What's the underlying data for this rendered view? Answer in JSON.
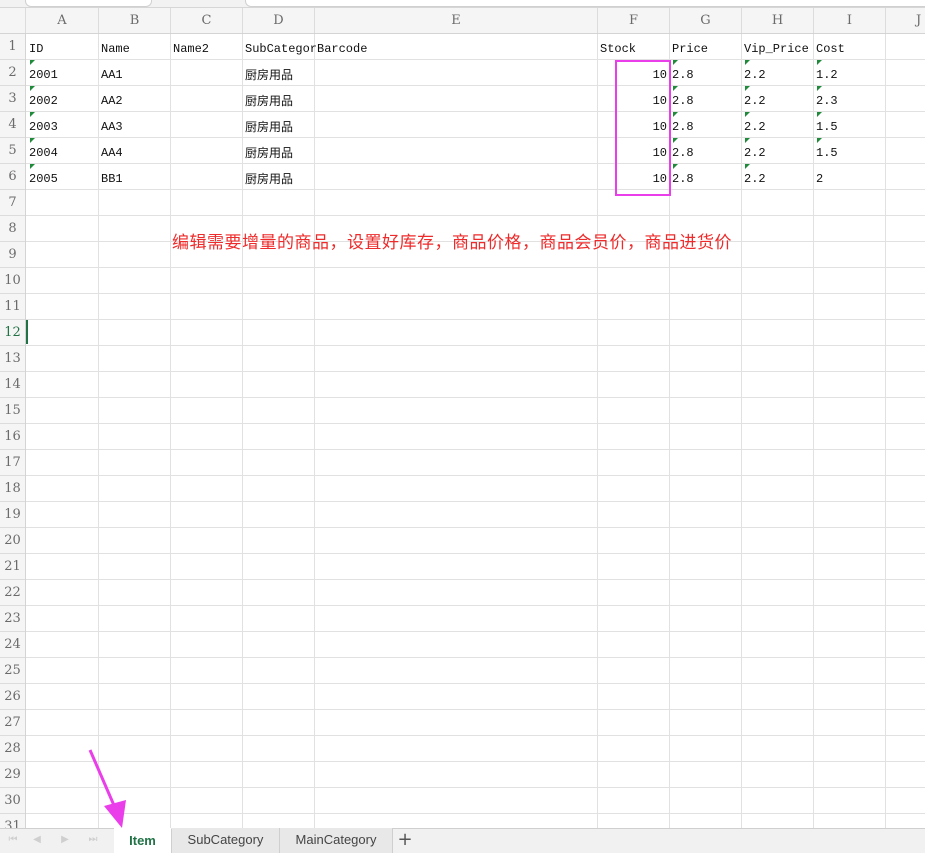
{
  "columns": [
    "A",
    "B",
    "C",
    "D",
    "E",
    "F",
    "G",
    "H",
    "I",
    "J"
  ],
  "rows": [
    "1",
    "2",
    "3",
    "4",
    "5",
    "6",
    "7",
    "8",
    "9",
    "10",
    "11",
    "12",
    "13",
    "14",
    "15",
    "16",
    "17",
    "18",
    "19",
    "20",
    "21",
    "22",
    "23",
    "24",
    "25",
    "26",
    "27",
    "28",
    "29",
    "30",
    "31"
  ],
  "active_row": "12",
  "headers": {
    "A": "ID",
    "B": "Name",
    "C": "Name2",
    "D": "SubCategor",
    "E": "Barcode",
    "F": "Stock",
    "G": "Price",
    "H": "Vip_Price",
    "I": "Cost"
  },
  "data_rows": [
    {
      "id": "2001",
      "name": "AA1",
      "subcategory": "厨房用品",
      "stock": "10",
      "price": "2.8",
      "vip_price": "2.2",
      "cost": "1.2"
    },
    {
      "id": "2002",
      "name": "AA2",
      "subcategory": "厨房用品",
      "stock": "10",
      "price": "2.8",
      "vip_price": "2.2",
      "cost": "2.3"
    },
    {
      "id": "2003",
      "name": "AA3",
      "subcategory": "厨房用品",
      "stock": "10",
      "price": "2.8",
      "vip_price": "2.2",
      "cost": "1.5"
    },
    {
      "id": "2004",
      "name": "AA4",
      "subcategory": "厨房用品",
      "stock": "10",
      "price": "2.8",
      "vip_price": "2.2",
      "cost": "1.5"
    },
    {
      "id": "2005",
      "name": "BB1",
      "subcategory": "厨房用品",
      "stock": "10",
      "price": "2.8",
      "vip_price": "2.2",
      "cost": "2"
    }
  ],
  "annotation_text": "编辑需要增量的商品，设置好库存，商品价格，商品会员价，商品进货价",
  "sheet_tabs": [
    {
      "label": "Item",
      "active": true
    },
    {
      "label": "SubCategory",
      "active": false
    },
    {
      "label": "MainCategory",
      "active": false
    }
  ],
  "colors": {
    "annotation": "#ee2a2a",
    "highlight": "#e93ee9",
    "active_tab": "#217346",
    "error_marker": "#1e8a3a"
  },
  "icons": {
    "add_sheet": "plus-icon",
    "nav": [
      "first-sheet-icon",
      "prev-sheet-icon",
      "next-sheet-icon",
      "last-sheet-icon"
    ]
  }
}
